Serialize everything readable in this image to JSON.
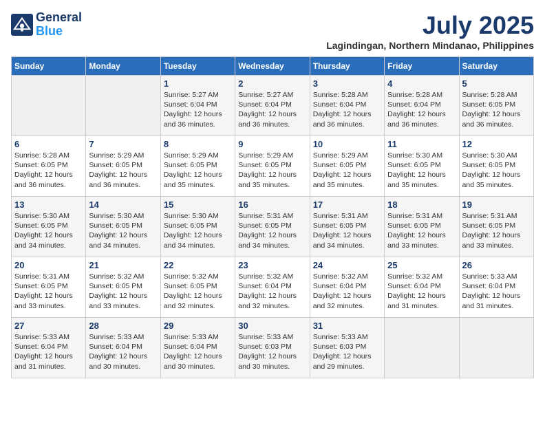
{
  "header": {
    "logo_line1": "General",
    "logo_line2": "Blue",
    "month_year": "July 2025",
    "location": "Lagindingan, Northern Mindanao, Philippines"
  },
  "weekdays": [
    "Sunday",
    "Monday",
    "Tuesday",
    "Wednesday",
    "Thursday",
    "Friday",
    "Saturday"
  ],
  "weeks": [
    [
      {
        "day": "",
        "sunrise": "",
        "sunset": "",
        "daylight": ""
      },
      {
        "day": "",
        "sunrise": "",
        "sunset": "",
        "daylight": ""
      },
      {
        "day": "1",
        "sunrise": "Sunrise: 5:27 AM",
        "sunset": "Sunset: 6:04 PM",
        "daylight": "Daylight: 12 hours and 36 minutes."
      },
      {
        "day": "2",
        "sunrise": "Sunrise: 5:27 AM",
        "sunset": "Sunset: 6:04 PM",
        "daylight": "Daylight: 12 hours and 36 minutes."
      },
      {
        "day": "3",
        "sunrise": "Sunrise: 5:28 AM",
        "sunset": "Sunset: 6:04 PM",
        "daylight": "Daylight: 12 hours and 36 minutes."
      },
      {
        "day": "4",
        "sunrise": "Sunrise: 5:28 AM",
        "sunset": "Sunset: 6:04 PM",
        "daylight": "Daylight: 12 hours and 36 minutes."
      },
      {
        "day": "5",
        "sunrise": "Sunrise: 5:28 AM",
        "sunset": "Sunset: 6:05 PM",
        "daylight": "Daylight: 12 hours and 36 minutes."
      }
    ],
    [
      {
        "day": "6",
        "sunrise": "Sunrise: 5:28 AM",
        "sunset": "Sunset: 6:05 PM",
        "daylight": "Daylight: 12 hours and 36 minutes."
      },
      {
        "day": "7",
        "sunrise": "Sunrise: 5:29 AM",
        "sunset": "Sunset: 6:05 PM",
        "daylight": "Daylight: 12 hours and 36 minutes."
      },
      {
        "day": "8",
        "sunrise": "Sunrise: 5:29 AM",
        "sunset": "Sunset: 6:05 PM",
        "daylight": "Daylight: 12 hours and 35 minutes."
      },
      {
        "day": "9",
        "sunrise": "Sunrise: 5:29 AM",
        "sunset": "Sunset: 6:05 PM",
        "daylight": "Daylight: 12 hours and 35 minutes."
      },
      {
        "day": "10",
        "sunrise": "Sunrise: 5:29 AM",
        "sunset": "Sunset: 6:05 PM",
        "daylight": "Daylight: 12 hours and 35 minutes."
      },
      {
        "day": "11",
        "sunrise": "Sunrise: 5:30 AM",
        "sunset": "Sunset: 6:05 PM",
        "daylight": "Daylight: 12 hours and 35 minutes."
      },
      {
        "day": "12",
        "sunrise": "Sunrise: 5:30 AM",
        "sunset": "Sunset: 6:05 PM",
        "daylight": "Daylight: 12 hours and 35 minutes."
      }
    ],
    [
      {
        "day": "13",
        "sunrise": "Sunrise: 5:30 AM",
        "sunset": "Sunset: 6:05 PM",
        "daylight": "Daylight: 12 hours and 34 minutes."
      },
      {
        "day": "14",
        "sunrise": "Sunrise: 5:30 AM",
        "sunset": "Sunset: 6:05 PM",
        "daylight": "Daylight: 12 hours and 34 minutes."
      },
      {
        "day": "15",
        "sunrise": "Sunrise: 5:30 AM",
        "sunset": "Sunset: 6:05 PM",
        "daylight": "Daylight: 12 hours and 34 minutes."
      },
      {
        "day": "16",
        "sunrise": "Sunrise: 5:31 AM",
        "sunset": "Sunset: 6:05 PM",
        "daylight": "Daylight: 12 hours and 34 minutes."
      },
      {
        "day": "17",
        "sunrise": "Sunrise: 5:31 AM",
        "sunset": "Sunset: 6:05 PM",
        "daylight": "Daylight: 12 hours and 34 minutes."
      },
      {
        "day": "18",
        "sunrise": "Sunrise: 5:31 AM",
        "sunset": "Sunset: 6:05 PM",
        "daylight": "Daylight: 12 hours and 33 minutes."
      },
      {
        "day": "19",
        "sunrise": "Sunrise: 5:31 AM",
        "sunset": "Sunset: 6:05 PM",
        "daylight": "Daylight: 12 hours and 33 minutes."
      }
    ],
    [
      {
        "day": "20",
        "sunrise": "Sunrise: 5:31 AM",
        "sunset": "Sunset: 6:05 PM",
        "daylight": "Daylight: 12 hours and 33 minutes."
      },
      {
        "day": "21",
        "sunrise": "Sunrise: 5:32 AM",
        "sunset": "Sunset: 6:05 PM",
        "daylight": "Daylight: 12 hours and 33 minutes."
      },
      {
        "day": "22",
        "sunrise": "Sunrise: 5:32 AM",
        "sunset": "Sunset: 6:05 PM",
        "daylight": "Daylight: 12 hours and 32 minutes."
      },
      {
        "day": "23",
        "sunrise": "Sunrise: 5:32 AM",
        "sunset": "Sunset: 6:04 PM",
        "daylight": "Daylight: 12 hours and 32 minutes."
      },
      {
        "day": "24",
        "sunrise": "Sunrise: 5:32 AM",
        "sunset": "Sunset: 6:04 PM",
        "daylight": "Daylight: 12 hours and 32 minutes."
      },
      {
        "day": "25",
        "sunrise": "Sunrise: 5:32 AM",
        "sunset": "Sunset: 6:04 PM",
        "daylight": "Daylight: 12 hours and 31 minutes."
      },
      {
        "day": "26",
        "sunrise": "Sunrise: 5:33 AM",
        "sunset": "Sunset: 6:04 PM",
        "daylight": "Daylight: 12 hours and 31 minutes."
      }
    ],
    [
      {
        "day": "27",
        "sunrise": "Sunrise: 5:33 AM",
        "sunset": "Sunset: 6:04 PM",
        "daylight": "Daylight: 12 hours and 31 minutes."
      },
      {
        "day": "28",
        "sunrise": "Sunrise: 5:33 AM",
        "sunset": "Sunset: 6:04 PM",
        "daylight": "Daylight: 12 hours and 30 minutes."
      },
      {
        "day": "29",
        "sunrise": "Sunrise: 5:33 AM",
        "sunset": "Sunset: 6:04 PM",
        "daylight": "Daylight: 12 hours and 30 minutes."
      },
      {
        "day": "30",
        "sunrise": "Sunrise: 5:33 AM",
        "sunset": "Sunset: 6:03 PM",
        "daylight": "Daylight: 12 hours and 30 minutes."
      },
      {
        "day": "31",
        "sunrise": "Sunrise: 5:33 AM",
        "sunset": "Sunset: 6:03 PM",
        "daylight": "Daylight: 12 hours and 29 minutes."
      },
      {
        "day": "",
        "sunrise": "",
        "sunset": "",
        "daylight": ""
      },
      {
        "day": "",
        "sunrise": "",
        "sunset": "",
        "daylight": ""
      }
    ]
  ]
}
